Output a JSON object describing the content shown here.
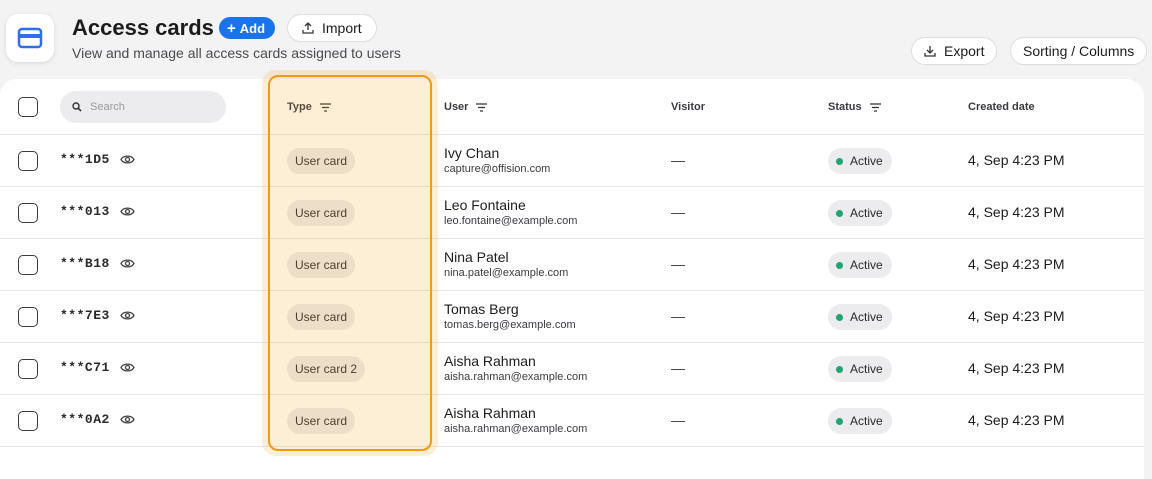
{
  "header": {
    "title": "Access cards",
    "subtitle": "View and manage all access cards assigned to users",
    "add_label": "Add",
    "import_label": "Import",
    "export_label": "Export",
    "sorting_label": "Sorting / Columns",
    "app_icon": "card-icon"
  },
  "search": {
    "placeholder": "Search",
    "value": ""
  },
  "columns": {
    "type": "Type",
    "user": "User",
    "visitor": "Visitor",
    "status": "Status",
    "created": "Created date"
  },
  "colors": {
    "accent": "#1a73e8",
    "highlight": "#f29a15",
    "status_active": "#1ea672"
  },
  "rows": [
    {
      "card_id": "***1D5",
      "type": "User card",
      "user_name": "Ivy Chan",
      "user_email": "capture@offision.com",
      "visitor": "—",
      "status": "Active",
      "created": "4, Sep 4:23 PM"
    },
    {
      "card_id": "***013",
      "type": "User card",
      "user_name": "Leo Fontaine",
      "user_email": "leo.fontaine@example.com",
      "visitor": "—",
      "status": "Active",
      "created": "4, Sep 4:23 PM"
    },
    {
      "card_id": "***B18",
      "type": "User card",
      "user_name": "Nina Patel",
      "user_email": "nina.patel@example.com",
      "visitor": "—",
      "status": "Active",
      "created": "4, Sep 4:23 PM"
    },
    {
      "card_id": "***7E3",
      "type": "User card",
      "user_name": "Tomas Berg",
      "user_email": "tomas.berg@example.com",
      "visitor": "—",
      "status": "Active",
      "created": "4, Sep 4:23 PM"
    },
    {
      "card_id": "***C71",
      "type": "User card 2",
      "user_name": "Aisha Rahman",
      "user_email": "aisha.rahman@example.com",
      "visitor": "—",
      "status": "Active",
      "created": "4, Sep 4:23 PM"
    },
    {
      "card_id": "***0A2",
      "type": "User card",
      "user_name": "Aisha Rahman",
      "user_email": "aisha.rahman@example.com",
      "visitor": "—",
      "status": "Active",
      "created": "4, Sep 4:23 PM"
    }
  ]
}
